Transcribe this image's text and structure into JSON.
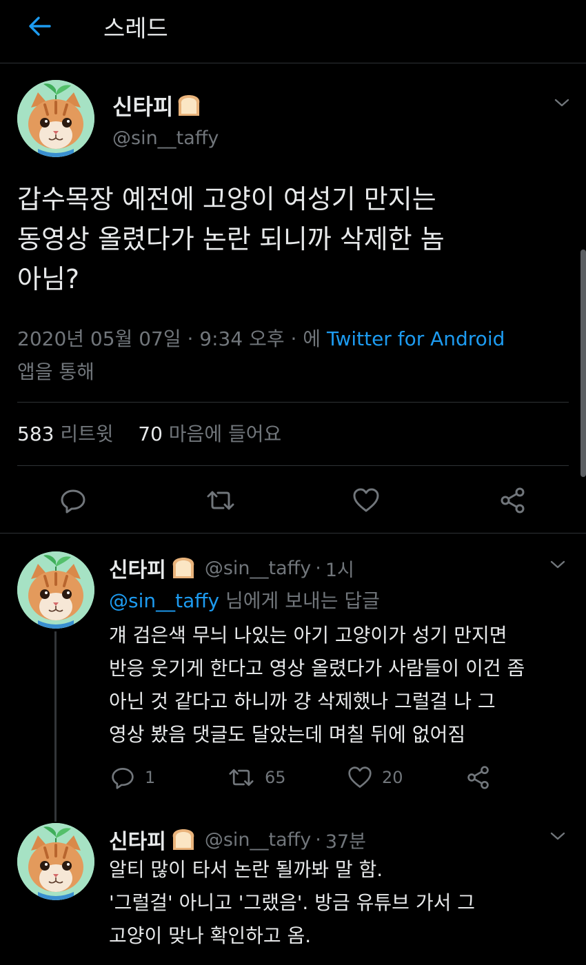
{
  "header": {
    "title": "스레드",
    "back_icon": "arrow-left-icon",
    "accent": "#1d9bf0"
  },
  "main_tweet": {
    "name": "신타피",
    "emoji_icon": "bread-icon",
    "handle": "@sin__taffy",
    "text_lines": [
      "갑수목장 예전에 고양이 여성기 만지는",
      "동영상 올렸다가 논란 되니까 삭제한 놈",
      "아님?"
    ],
    "meta_before": "2020년 05월 07일 · 9:34 오후 · 에 ",
    "meta_link": "Twitter for Android",
    "meta_after": "앱을 통해",
    "retweets_count": "583",
    "retweets_label": "리트윗",
    "likes_count": "70",
    "likes_label": "마음에 들어요"
  },
  "replies": [
    {
      "name": "신타피",
      "handle": "@sin__taffy",
      "dot": "·",
      "time": "1시",
      "reply_to_handle": "@sin__taffy",
      "reply_to_suffix": " 님에게 보내는 답글",
      "text_lines": [
        "걔 검은색 무늬 나있는 아기 고양이가 성기 만지면",
        "반응 웃기게 한다고 영상 올렸다가 사람들이 이건 좀",
        "아닌 것 같다고 하니까 걍 삭제했나 그럴걸 나 그",
        "영상 봤음 댓글도 달았는데 며칠 뒤에 없어짐"
      ],
      "reply_count": "1",
      "retweet_count": "65",
      "like_count": "20"
    },
    {
      "name": "신타피",
      "handle": "@sin__taffy",
      "dot": "·",
      "time": "37분",
      "text_lines": [
        "알티 많이 타서 논란 될까봐 말 함.",
        "'그럴걸' 아니고 '그랬음'. 방금 유튜브 가서 그",
        "고양이 맞나 확인하고 옴."
      ]
    }
  ]
}
